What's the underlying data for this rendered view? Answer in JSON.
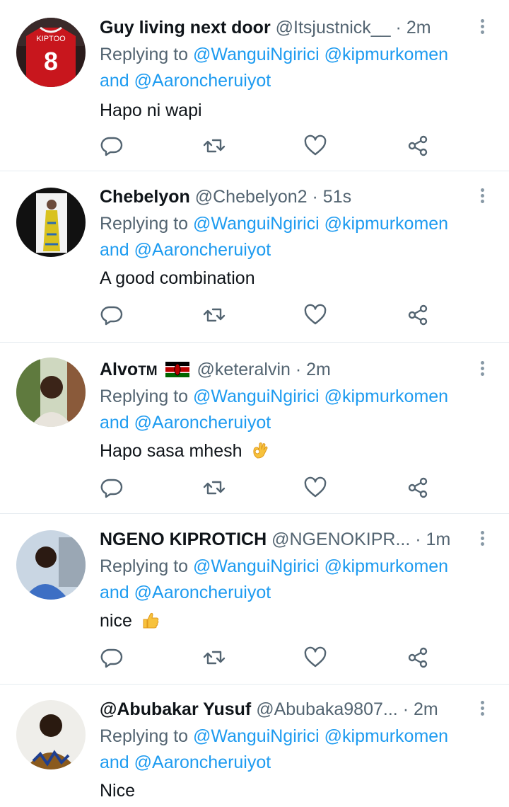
{
  "replies": [
    {
      "name": "Guy living next door",
      "handle": "@Itsjustnick__",
      "time": "· 2m",
      "avatar_icon": "avatar-jersey-photo",
      "avatar_text": "KIPTOO",
      "avatar_number": "8",
      "replying_prefix": "Replying to",
      "mention1": "@WanguiNgirici",
      "mention2": "@kipmurkomen",
      "and": "and",
      "mention3": "@Aaroncheruiyot",
      "text": "Hapo ni wapi"
    },
    {
      "name": "Chebelyon",
      "handle": "@Chebelyon2",
      "time": "· 51s",
      "avatar_icon": "avatar-woman-yellow-dress-photo",
      "replying_prefix": "Replying to",
      "mention1": "@WanguiNgirici",
      "mention2": "@kipmurkomen",
      "and": "and",
      "mention3": "@Aaroncheruiyot",
      "text": "A good combination"
    },
    {
      "name": "Alvo",
      "name_suffix": "TM",
      "handle": "@keteralvin",
      "time": "· 2m",
      "avatar_icon": "avatar-man-outdoors-photo",
      "replying_prefix": "Replying to",
      "mention1": "@WanguiNgirici",
      "mention2": "@kipmurkomen",
      "and": "and",
      "mention3": "@Aaroncheruiyot",
      "text": "Hapo sasa mhesh",
      "emoji": "ok-hand-emoji"
    },
    {
      "name": "NGENO KIPROTICH",
      "handle": "@NGENOKIPR...",
      "time": "· 1m",
      "avatar_icon": "avatar-man-blue-shirt-photo",
      "replying_prefix": "Replying to",
      "mention1": "@WanguiNgirici",
      "mention2": "@kipmurkomen",
      "and": "and",
      "mention3": "@Aaroncheruiyot",
      "text": "nice",
      "emoji": "thumbs-up-emoji"
    },
    {
      "name": "@Abubakar Yusuf",
      "handle": "@Abubaka9807...",
      "time": "· 2m",
      "avatar_icon": "avatar-man-patterned-shirt-photo",
      "replying_prefix": "Replying to",
      "mention1": "@WanguiNgirici",
      "mention2": "@kipmurkomen",
      "and": "and",
      "mention3": "@Aaroncheruiyot",
      "text": "Nice"
    }
  ],
  "icons": {
    "reply": "reply-icon",
    "retweet": "retweet-icon",
    "like": "heart-icon",
    "share": "share-icon",
    "more": "more-vertical-icon"
  },
  "colors": {
    "link": "#1d9bf0",
    "secondary_text": "#536471",
    "primary_text": "#0f1419",
    "icon": "#536471",
    "divider": "#e6ecf0"
  }
}
